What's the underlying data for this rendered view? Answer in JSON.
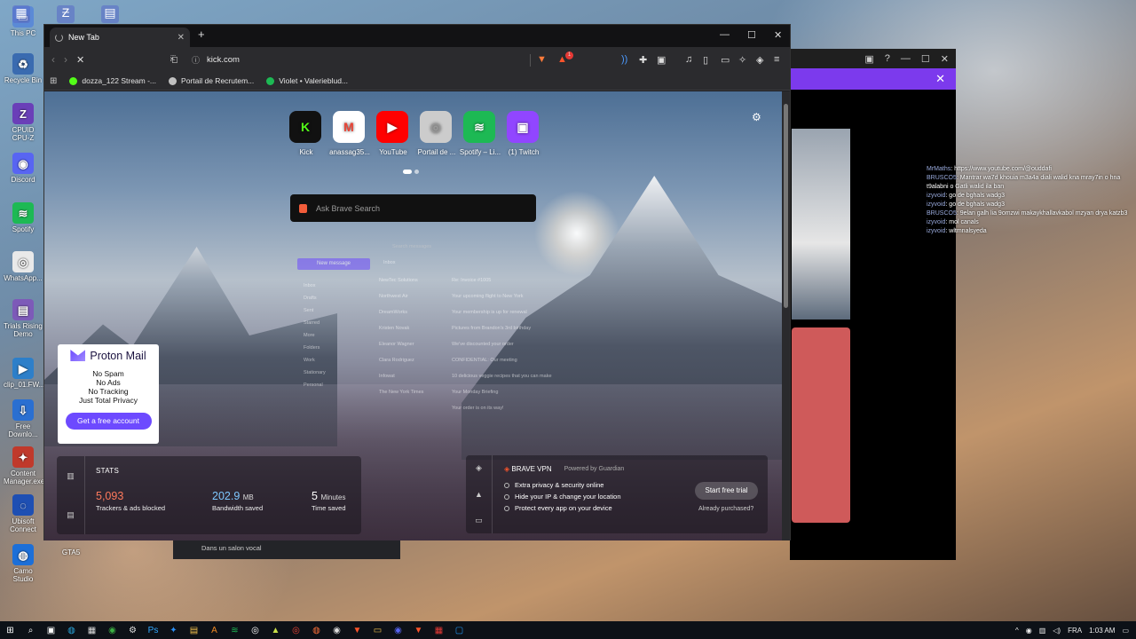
{
  "desktop": {
    "icons": [
      {
        "label": "This PC",
        "icon": "pc-icon",
        "color": "#5b8ad6",
        "glyph": "▭"
      },
      {
        "label": "Recycle Bin",
        "icon": "recycle-bin-icon",
        "color": "#3a6bb0",
        "glyph": "♻"
      },
      {
        "label": "CPUID CPU-Z",
        "icon": "cpuz-icon",
        "color": "#6a3fb8",
        "glyph": "Z"
      },
      {
        "label": "Discord",
        "icon": "discord-icon",
        "color": "#5865f2",
        "glyph": "◉"
      },
      {
        "label": "Spotify",
        "icon": "spotify-icon",
        "color": "#1db954",
        "glyph": "≋"
      },
      {
        "label": "WhatsApp...",
        "icon": "chrome-icon",
        "color": "#e9e9e9",
        "glyph": "◎"
      },
      {
        "label": "Trials Rising Demo",
        "icon": "trials-icon",
        "color": "#7d5ab8",
        "glyph": "▤"
      },
      {
        "label": "clip_01.FW...",
        "icon": "clip-icon",
        "color": "#2d7fc9",
        "glyph": "▶"
      },
      {
        "label": "Free Downlo...",
        "icon": "download-icon",
        "color": "#2a6fd1",
        "glyph": "⇩"
      },
      {
        "label": "Content Manager.exe",
        "icon": "content-manager-icon",
        "color": "#c0392b",
        "glyph": "✦"
      },
      {
        "label": "Ubisoft Connect",
        "icon": "ubisoft-icon",
        "color": "#1e4fb3",
        "glyph": "◌"
      },
      {
        "label": "Camo Studio",
        "icon": "camo-icon",
        "color": "#1c6fd8",
        "glyph": "◍"
      }
    ],
    "top_icons": [
      {
        "icon": "app-icon-1",
        "glyph": "▦"
      },
      {
        "icon": "app-icon-2",
        "glyph": "Ƶ"
      },
      {
        "icon": "app-icon-3",
        "glyph": "▤"
      }
    ],
    "gta_icon_label": "GTA5"
  },
  "bg_window": {
    "controls": [
      "▣",
      "?",
      "—",
      "☐",
      "✕"
    ],
    "banner_close": "✕",
    "chat": [
      {
        "user": "MrMaths",
        "text": ": https://www.youtube.com/@ouddafi"
      },
      {
        "user": "BRUSCO5",
        "text": ": Mantrar wa7d khouia m3a4a diali walid kna mray7in o hna t9alabni o Gatli walid ila ban"
      },
      {
        "user": "izyvoid",
        "text": ": go de bghals wadg3"
      },
      {
        "user": "izyvoid",
        "text": ": go de bghals wadg3"
      },
      {
        "user": "BRUSCO5",
        "text": ": 9elan galh lia 9omzwi makaykhallavkabol mzyan drya katzb3"
      },
      {
        "user": "izyvoid",
        "text": ": mol canals"
      },
      {
        "user": "izyvoid",
        "text": ": wltmnalsyeda"
      }
    ]
  },
  "browser": {
    "tab_title": "New Tab",
    "tab_close": "✕",
    "new_tab": "+",
    "window_controls": [
      "—",
      "☐",
      "✕"
    ],
    "url": "kick.com",
    "shields_badge": "1",
    "bookmarks": [
      {
        "label": "dozza_122 Stream -...",
        "color": "#53fc18"
      },
      {
        "label": "Portail de Recrutem...",
        "color": "#c0c0c0"
      },
      {
        "label": "Violet • Valerieblud...",
        "color": "#1db954"
      }
    ],
    "tiles": [
      {
        "label": "Kick",
        "glyph": "K",
        "color": "#53fc18",
        "bg": "#111"
      },
      {
        "label": "anassag35...",
        "glyph": "M",
        "color": "#ea4335",
        "bg": "#fff"
      },
      {
        "label": "YouTube",
        "glyph": "▶",
        "color": "#fff",
        "bg": "#ff0000"
      },
      {
        "label": "Portail de ...",
        "glyph": "◎",
        "color": "#999",
        "bg": "#ccc"
      },
      {
        "label": "Spotify – Li...",
        "glyph": "≋",
        "color": "#fff",
        "bg": "#1db954"
      },
      {
        "label": "(1) Twitch",
        "glyph": "▣",
        "color": "#fff",
        "bg": "#9146ff"
      }
    ],
    "search_placeholder": "Ask Brave Search",
    "proton_preview": {
      "new_message": "New message",
      "inbox": "Inbox",
      "search": "Search messages",
      "folders": [
        "Inbox",
        "Drafts",
        "Sent",
        "Starred",
        "More",
        "Folders",
        "Work",
        "Stationary",
        "Personal"
      ],
      "rows": [
        {
          "from": "NewTec Solutions",
          "subject": "Re: Invoice #1005"
        },
        {
          "from": "Northwest Air",
          "subject": "Your upcoming flight to New York"
        },
        {
          "from": "DreamWorks",
          "subject": "Your membership is up for renewal"
        },
        {
          "from": "Kristen Novak",
          "subject": "Pictures from Brandon's 3rd birthday"
        },
        {
          "from": "Eleanor Wagner",
          "subject": "We've discounted your order"
        },
        {
          "from": "Clara Rodriguez",
          "subject": "CONFIDENTIAL: Our meeting"
        },
        {
          "from": "Infowat",
          "subject": "10 delicious veggie recipes that you can make"
        },
        {
          "from": "The New York Times",
          "subject": "Your Monday Briefing"
        },
        {
          "from": "",
          "subject": "Your order is on its way!"
        }
      ]
    },
    "proton_ad": {
      "brand": "Proton Mail",
      "lines": [
        "No Spam",
        "No Ads",
        "No Tracking",
        "Just Total Privacy"
      ],
      "cta": "Get a free account"
    },
    "stats": {
      "title": "STATS",
      "items": [
        {
          "value": "5,093",
          "unit": "",
          "label": "Trackers & ads blocked",
          "color": "#ff7a5c"
        },
        {
          "value": "202.9",
          "unit": "MB",
          "label": "Bandwidth saved",
          "color": "#7ec8ff"
        },
        {
          "value": "5",
          "unit": "Minutes",
          "label": "Time saved",
          "color": "#ffffff"
        }
      ]
    },
    "vpn": {
      "brand": "BRAVE VPN",
      "powered_by": "Powered by  Guardian",
      "features": [
        "Extra privacy & security online",
        "Hide your IP & change your location",
        "Protect every app on your device"
      ],
      "cta": "Start free trial",
      "already": "Already purchased?"
    }
  },
  "discord": {
    "status": "Dans un salon vocal"
  },
  "taskbar": {
    "icons": [
      {
        "icon": "windows-start-icon",
        "glyph": "⊞",
        "color": "#fff"
      },
      {
        "icon": "search-icon",
        "glyph": "⌕",
        "color": "#fff"
      },
      {
        "icon": "task-view-icon",
        "glyph": "▣",
        "color": "#fff"
      },
      {
        "icon": "edge-icon",
        "glyph": "◍",
        "color": "#29a8e0"
      },
      {
        "icon": "store-icon",
        "glyph": "▦",
        "color": "#ddd"
      },
      {
        "icon": "xbox-icon",
        "glyph": "◉",
        "color": "#3cb043"
      },
      {
        "icon": "settings-icon",
        "glyph": "⚙",
        "color": "#ddd"
      },
      {
        "icon": "photoshop-icon",
        "glyph": "Ps",
        "color": "#31a8ff"
      },
      {
        "icon": "app-icon",
        "glyph": "✦",
        "color": "#2a8ff7"
      },
      {
        "icon": "folder-icon",
        "glyph": "▤",
        "color": "#f2c14e"
      },
      {
        "icon": "notes-icon",
        "glyph": "A",
        "color": "#f08a24"
      },
      {
        "icon": "spotify-icon",
        "glyph": "≋",
        "color": "#1db954"
      },
      {
        "icon": "steam-icon",
        "glyph": "◎",
        "color": "#fff"
      },
      {
        "icon": "game-icon",
        "glyph": "▲",
        "color": "#c9e04a"
      },
      {
        "icon": "chrome-icon",
        "glyph": "◎",
        "color": "#ea4335"
      },
      {
        "icon": "firefox-icon",
        "glyph": "◍",
        "color": "#ff7139"
      },
      {
        "icon": "github-icon",
        "glyph": "◉",
        "color": "#ddd"
      },
      {
        "icon": "brave-icon",
        "glyph": "▼",
        "color": "#fb542b"
      },
      {
        "icon": "explorer-icon",
        "glyph": "▭",
        "color": "#f2c14e"
      },
      {
        "icon": "discord-icon",
        "glyph": "◉",
        "color": "#5865f2"
      },
      {
        "icon": "brave-active-icon",
        "glyph": "▼",
        "color": "#fb542b"
      },
      {
        "icon": "app-red-icon",
        "glyph": "▦",
        "color": "#e53935"
      },
      {
        "icon": "app-blue-icon",
        "glyph": "▢",
        "color": "#2196f3"
      }
    ],
    "tray": {
      "chevron": "^",
      "lang": "FRA",
      "time": "1:03 AM"
    }
  }
}
